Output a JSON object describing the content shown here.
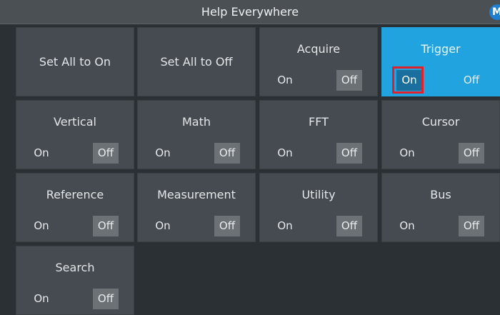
{
  "title": "Help Everywhere",
  "menu_badge": "M",
  "actions": {
    "set_all_on": "Set All to On",
    "set_all_off": "Set All to Off"
  },
  "option_labels": {
    "on": "On",
    "off": "Off"
  },
  "tiles": [
    {
      "label": "Acquire",
      "selected": "Off"
    },
    {
      "label": "Trigger",
      "selected": "On",
      "active": true
    },
    {
      "label": "Vertical",
      "selected": "Off"
    },
    {
      "label": "Math",
      "selected": "Off"
    },
    {
      "label": "FFT",
      "selected": "Off"
    },
    {
      "label": "Cursor",
      "selected": "Off"
    },
    {
      "label": "Reference",
      "selected": "Off"
    },
    {
      "label": "Measurement",
      "selected": "Off"
    },
    {
      "label": "Utility",
      "selected": "Off"
    },
    {
      "label": "Bus",
      "selected": "Off"
    },
    {
      "label": "Search",
      "selected": "Off"
    }
  ],
  "colors": {
    "background": "#2b3034",
    "tile": "#454b50",
    "selected_option": "#6b7175",
    "active_tile": "#21a3df",
    "highlight": "#e0202a"
  }
}
